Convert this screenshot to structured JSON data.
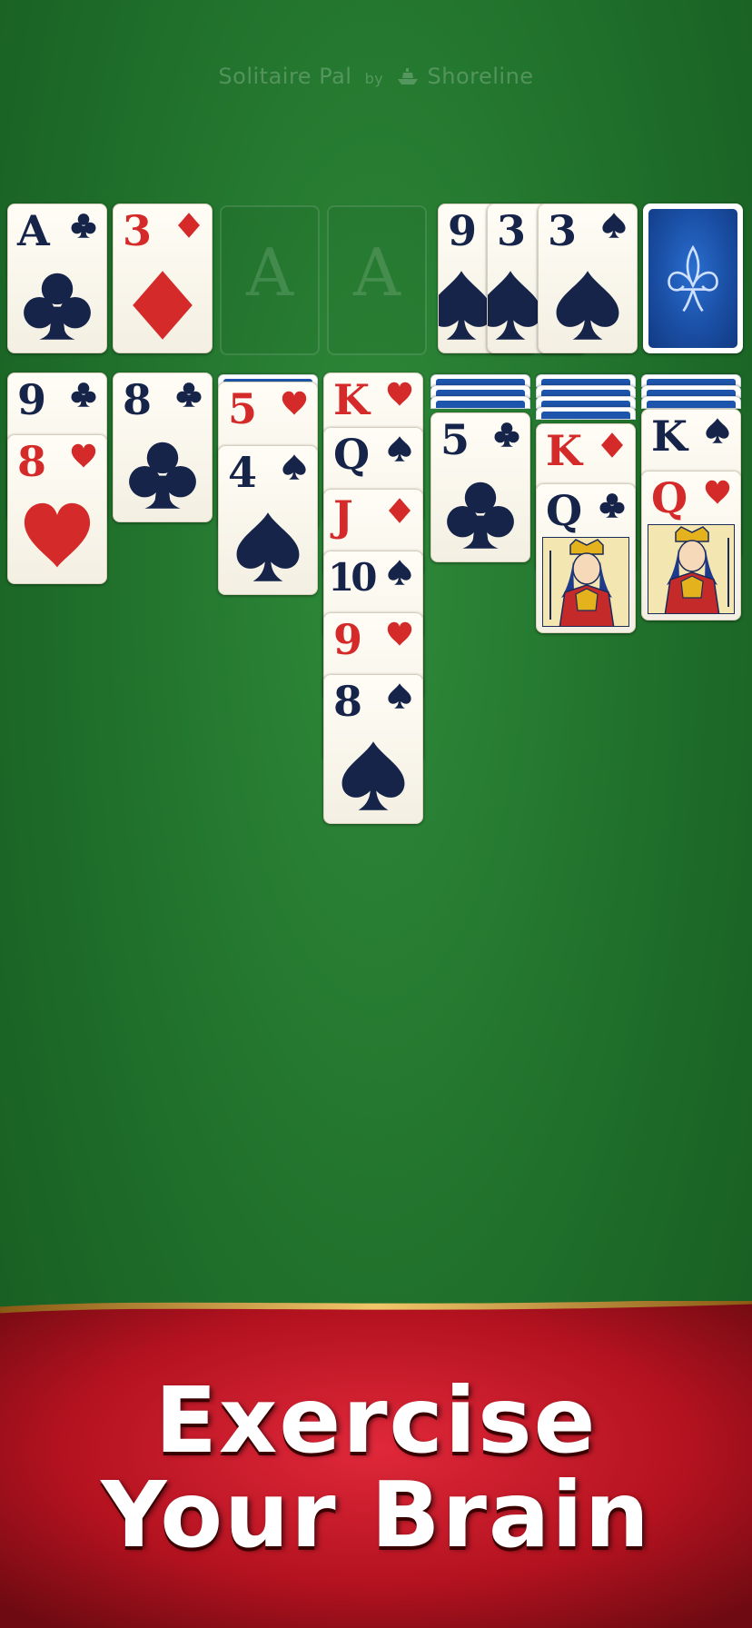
{
  "header": {
    "brand_name": "Solitaire Pal",
    "brand_by": "by",
    "brand_company": "Shoreline"
  },
  "foundations": [
    {
      "rank": "A",
      "suit": "clubs",
      "color": "black"
    },
    {
      "rank": "3",
      "suit": "diamonds",
      "color": "red"
    },
    {
      "placeholder": "A"
    },
    {
      "placeholder": "A"
    }
  ],
  "waste": [
    {
      "rank": "9",
      "suit": "spades"
    },
    {
      "rank": "3",
      "suit": "spades"
    },
    {
      "rank": "3",
      "suit": "spades"
    }
  ],
  "tableau": [
    {
      "hidden": 0,
      "cards": [
        {
          "rank": "9",
          "suit": "clubs"
        },
        {
          "rank": "8",
          "suit": "hearts"
        }
      ]
    },
    {
      "hidden": 0,
      "cards": [
        {
          "rank": "8",
          "suit": "clubs"
        }
      ]
    },
    {
      "hidden": 1,
      "cards": [
        {
          "rank": "5",
          "suit": "hearts"
        },
        {
          "rank": "4",
          "suit": "spades"
        }
      ]
    },
    {
      "hidden": 0,
      "cards": [
        {
          "rank": "K",
          "suit": "hearts"
        },
        {
          "rank": "Q",
          "suit": "spades"
        },
        {
          "rank": "J",
          "suit": "diamonds"
        },
        {
          "rank": "10",
          "suit": "spades"
        },
        {
          "rank": "9",
          "suit": "hearts"
        },
        {
          "rank": "8",
          "suit": "spades"
        }
      ]
    },
    {
      "hidden": 3,
      "cards": [
        {
          "rank": "5",
          "suit": "clubs"
        }
      ]
    },
    {
      "hidden": 4,
      "cards": [
        {
          "rank": "K",
          "suit": "diamonds"
        },
        {
          "rank": "Q",
          "suit": "clubs"
        }
      ]
    },
    {
      "hidden": 3,
      "cards": [
        {
          "rank": "K",
          "suit": "spades"
        },
        {
          "rank": "Q",
          "suit": "hearts"
        }
      ]
    }
  ],
  "banner": {
    "line1": "Exercise",
    "line2": "Your Brain"
  },
  "colors": {
    "felt": "#1f6e2a",
    "red_suit": "#d42a2a",
    "black_suit": "#16244a",
    "card_back": "#1a4fa5",
    "banner_red": "#b3121f",
    "banner_gold": "#d9a441"
  }
}
